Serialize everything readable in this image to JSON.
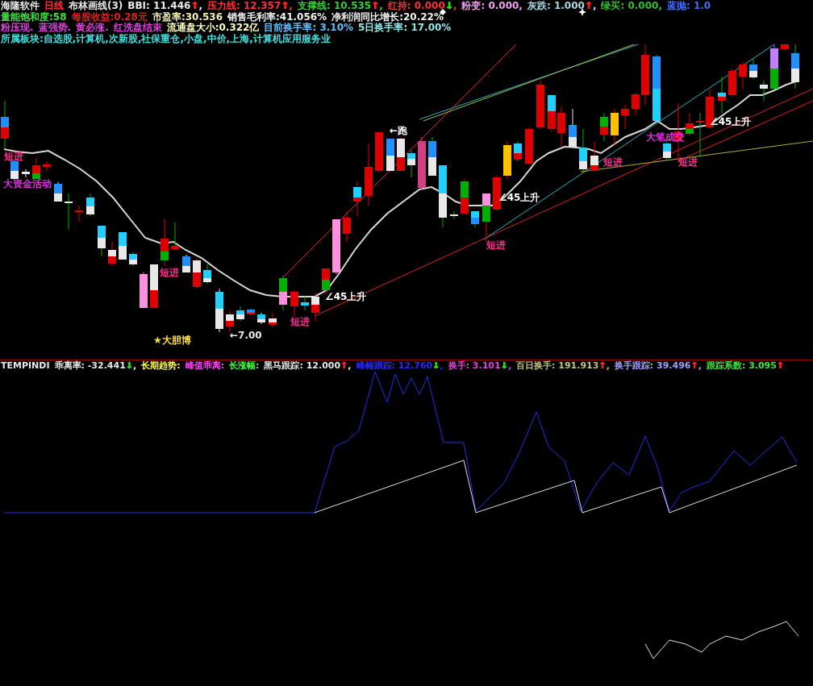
{
  "header": {
    "rows": [
      {
        "items": [
          {
            "text": "海隆软件",
            "color": "#e8e8e8"
          },
          {
            "text": "日线",
            "color": "#ff3030"
          },
          {
            "text": "布林画线(3)",
            "color": "#e8e8e8"
          },
          {
            "text": "BBI: 11.446",
            "arrow": {
              "text": "↑",
              "color": "#ff2020"
            },
            "tail": ",",
            "color": "#e8e8e8"
          },
          {
            "text": "压力线: 12.357",
            "arrow": {
              "text": "↑",
              "color": "#ff2020"
            },
            "tail": ",",
            "color": "#ff3030"
          },
          {
            "text": "支撑线: 10.535",
            "arrow": {
              "text": "↑",
              "color": "#ff2020"
            },
            "tail": ",",
            "color": "#30d030"
          },
          {
            "text": "红持: 0.000",
            "arrow": {
              "text": "↓",
              "color": "#20e020"
            },
            "tail": ",",
            "color": "#ff3030"
          },
          {
            "text": "粉变: 0.000,",
            "color": "#f0a0f0"
          },
          {
            "text": "灰跌: 1.000",
            "arrow": {
              "text": "↑",
              "color": "#ff2020"
            },
            "tail": ",",
            "color": "#a8d8e0"
          },
          {
            "text": "绿买: 0.000,",
            "color": "#30c030"
          },
          {
            "text": "蓝抛: 1.0",
            "color": "#4070ff"
          }
        ]
      },
      {
        "items": [
          {
            "text": "量能饱和度:58",
            "color": "#40e040"
          },
          {
            "text": "每股收益:0.28元",
            "color": "#e02020"
          },
          {
            "text": "市盈率:30.536",
            "color": "#f0f0b0"
          },
          {
            "text": "销售毛利率:41.056%",
            "color": "#f0f0f0"
          },
          {
            "text": "净利润同比增长:20.22%",
            "color": "#f0f0f0"
          }
        ]
      },
      {
        "items": [
          {
            "text": "粉压现.",
            "color": "#e040e0"
          },
          {
            "text": "蓝强势.",
            "color": "#e040e0"
          },
          {
            "text": "黄必涨.",
            "color": "#e040e0"
          },
          {
            "text": "红洗盘结束",
            "color": "#e040e0"
          },
          {
            "text": "流通盘大小:0.322亿",
            "color": "#ffffc0"
          },
          {
            "text": "目前换手率: 3.10%",
            "color": "#60c0ff"
          },
          {
            "text": "5日换手率: 17.00%",
            "color": "#90e8e8"
          }
        ]
      },
      {
        "items": [
          {
            "text": "所属板块:自选股,计算机,次新股,社保重仓,小盘,中价,上海,计算机应用服务业",
            "color": "#40e0e0"
          }
        ]
      }
    ]
  },
  "chart": {
    "labels": [
      {
        "text": "短进",
        "color": "#ff3090"
      },
      {
        "text": "大资金活动",
        "color": "#e030e0"
      },
      {
        "text": "短进",
        "color": "#ff3090"
      },
      {
        "text": "★大胆博",
        "color": "#ffe040"
      },
      {
        "text": "←7.00",
        "color": "#e8e8e8"
      },
      {
        "text": "短进",
        "color": "#ff3090"
      },
      {
        "text": "∠45上升",
        "color": "#ffffff"
      },
      {
        "text": "←跑",
        "color": "#ffffff"
      },
      {
        "text": "短进",
        "color": "#ff3090"
      },
      {
        "text": "∠45上升",
        "color": "#ffffff"
      },
      {
        "text": "短进",
        "color": "#ff3090"
      },
      {
        "text": "大笔成交",
        "color": "#e030e0"
      },
      {
        "text": "短进",
        "color": "#ff3090"
      },
      {
        "text": "∠45上升",
        "color": "#ffffff"
      }
    ]
  },
  "indicator": {
    "items": [
      {
        "text": "TEMPINDI",
        "color": "#e8e8e8"
      },
      {
        "text": "乖离率: -32.441",
        "arrow": {
          "text": "↓",
          "color": "#20e020"
        },
        "tail": ",",
        "color": "#e8e8e8"
      },
      {
        "text": "长期趋势:",
        "color": "#ffff40"
      },
      {
        "text": "峰值乖离:",
        "color": "#ff40ff"
      },
      {
        "text": "长涨幅:",
        "color": "#40ff40"
      },
      {
        "text": "黑马跟踪: 12.000",
        "arrow": {
          "text": "↑",
          "color": "#ff2020"
        },
        "tail": ",",
        "color": "#e8e8e8"
      },
      {
        "text": "峰幅跟踪: 12.760",
        "arrow": {
          "text": "↓",
          "color": "#20e020"
        },
        "tail": ",",
        "color": "#2828ff"
      },
      {
        "text": "换手: 3.101",
        "arrow": {
          "text": "↓",
          "color": "#20e020"
        },
        "tail": ",",
        "color": "#e040e0"
      },
      {
        "text": "百日换手: 191.913",
        "arrow": {
          "text": "↑",
          "color": "#ff2020"
        },
        "tail": ",",
        "color": "#c0c080"
      },
      {
        "text": "换手跟踪: 39.496",
        "arrow": {
          "text": "↑",
          "color": "#ff2020"
        },
        "tail": ",",
        "color": "#a0a0ff"
      },
      {
        "text": "跟踪系数: 3.095",
        "arrow": {
          "text": "↑",
          "color": "#ff2020"
        },
        "color": "#40e040"
      }
    ]
  }
}
